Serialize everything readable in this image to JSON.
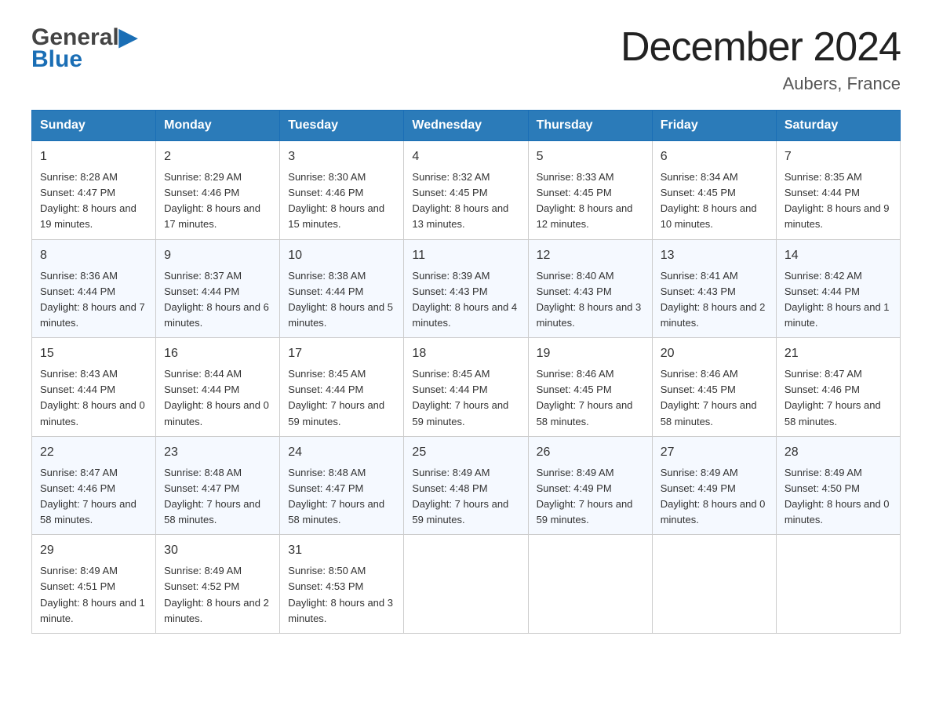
{
  "header": {
    "logo_general": "General",
    "logo_blue": "Blue",
    "month_title": "December 2024",
    "location": "Aubers, France"
  },
  "days_of_week": [
    "Sunday",
    "Monday",
    "Tuesday",
    "Wednesday",
    "Thursday",
    "Friday",
    "Saturday"
  ],
  "weeks": [
    [
      {
        "day": "1",
        "sunrise": "8:28 AM",
        "sunset": "4:47 PM",
        "daylight": "8 hours and 19 minutes."
      },
      {
        "day": "2",
        "sunrise": "8:29 AM",
        "sunset": "4:46 PM",
        "daylight": "8 hours and 17 minutes."
      },
      {
        "day": "3",
        "sunrise": "8:30 AM",
        "sunset": "4:46 PM",
        "daylight": "8 hours and 15 minutes."
      },
      {
        "day": "4",
        "sunrise": "8:32 AM",
        "sunset": "4:45 PM",
        "daylight": "8 hours and 13 minutes."
      },
      {
        "day": "5",
        "sunrise": "8:33 AM",
        "sunset": "4:45 PM",
        "daylight": "8 hours and 12 minutes."
      },
      {
        "day": "6",
        "sunrise": "8:34 AM",
        "sunset": "4:45 PM",
        "daylight": "8 hours and 10 minutes."
      },
      {
        "day": "7",
        "sunrise": "8:35 AM",
        "sunset": "4:44 PM",
        "daylight": "8 hours and 9 minutes."
      }
    ],
    [
      {
        "day": "8",
        "sunrise": "8:36 AM",
        "sunset": "4:44 PM",
        "daylight": "8 hours and 7 minutes."
      },
      {
        "day": "9",
        "sunrise": "8:37 AM",
        "sunset": "4:44 PM",
        "daylight": "8 hours and 6 minutes."
      },
      {
        "day": "10",
        "sunrise": "8:38 AM",
        "sunset": "4:44 PM",
        "daylight": "8 hours and 5 minutes."
      },
      {
        "day": "11",
        "sunrise": "8:39 AM",
        "sunset": "4:43 PM",
        "daylight": "8 hours and 4 minutes."
      },
      {
        "day": "12",
        "sunrise": "8:40 AM",
        "sunset": "4:43 PM",
        "daylight": "8 hours and 3 minutes."
      },
      {
        "day": "13",
        "sunrise": "8:41 AM",
        "sunset": "4:43 PM",
        "daylight": "8 hours and 2 minutes."
      },
      {
        "day": "14",
        "sunrise": "8:42 AM",
        "sunset": "4:44 PM",
        "daylight": "8 hours and 1 minute."
      }
    ],
    [
      {
        "day": "15",
        "sunrise": "8:43 AM",
        "sunset": "4:44 PM",
        "daylight": "8 hours and 0 minutes."
      },
      {
        "day": "16",
        "sunrise": "8:44 AM",
        "sunset": "4:44 PM",
        "daylight": "8 hours and 0 minutes."
      },
      {
        "day": "17",
        "sunrise": "8:45 AM",
        "sunset": "4:44 PM",
        "daylight": "7 hours and 59 minutes."
      },
      {
        "day": "18",
        "sunrise": "8:45 AM",
        "sunset": "4:44 PM",
        "daylight": "7 hours and 59 minutes."
      },
      {
        "day": "19",
        "sunrise": "8:46 AM",
        "sunset": "4:45 PM",
        "daylight": "7 hours and 58 minutes."
      },
      {
        "day": "20",
        "sunrise": "8:46 AM",
        "sunset": "4:45 PM",
        "daylight": "7 hours and 58 minutes."
      },
      {
        "day": "21",
        "sunrise": "8:47 AM",
        "sunset": "4:46 PM",
        "daylight": "7 hours and 58 minutes."
      }
    ],
    [
      {
        "day": "22",
        "sunrise": "8:47 AM",
        "sunset": "4:46 PM",
        "daylight": "7 hours and 58 minutes."
      },
      {
        "day": "23",
        "sunrise": "8:48 AM",
        "sunset": "4:47 PM",
        "daylight": "7 hours and 58 minutes."
      },
      {
        "day": "24",
        "sunrise": "8:48 AM",
        "sunset": "4:47 PM",
        "daylight": "7 hours and 58 minutes."
      },
      {
        "day": "25",
        "sunrise": "8:49 AM",
        "sunset": "4:48 PM",
        "daylight": "7 hours and 59 minutes."
      },
      {
        "day": "26",
        "sunrise": "8:49 AM",
        "sunset": "4:49 PM",
        "daylight": "7 hours and 59 minutes."
      },
      {
        "day": "27",
        "sunrise": "8:49 AM",
        "sunset": "4:49 PM",
        "daylight": "8 hours and 0 minutes."
      },
      {
        "day": "28",
        "sunrise": "8:49 AM",
        "sunset": "4:50 PM",
        "daylight": "8 hours and 0 minutes."
      }
    ],
    [
      {
        "day": "29",
        "sunrise": "8:49 AM",
        "sunset": "4:51 PM",
        "daylight": "8 hours and 1 minute."
      },
      {
        "day": "30",
        "sunrise": "8:49 AM",
        "sunset": "4:52 PM",
        "daylight": "8 hours and 2 minutes."
      },
      {
        "day": "31",
        "sunrise": "8:50 AM",
        "sunset": "4:53 PM",
        "daylight": "8 hours and 3 minutes."
      },
      null,
      null,
      null,
      null
    ]
  ],
  "labels": {
    "sunrise": "Sunrise:",
    "sunset": "Sunset:",
    "daylight": "Daylight:"
  }
}
